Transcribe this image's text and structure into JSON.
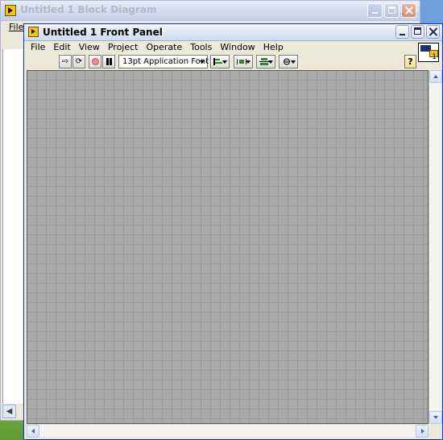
{
  "block_diagram": {
    "title": "Untitled 1 Block Diagram",
    "menu": {
      "file": "File"
    }
  },
  "front_panel": {
    "title": "Untitled 1 Front Panel",
    "menu": [
      "File",
      "Edit",
      "View",
      "Project",
      "Operate",
      "Tools",
      "Window",
      "Help"
    ],
    "toolbar": {
      "font_select_value": "13pt Application Font",
      "help_label": "?"
    },
    "vi_icon": {
      "number": "1"
    }
  },
  "colors": {
    "active_title_border": "#0831d9",
    "canvas_grid": "#a9a9a9"
  },
  "icons": {
    "run": "run-arrow-icon",
    "run_continuous": "run-continuous-icon",
    "abort": "abort-stop-icon",
    "pause": "pause-icon",
    "align": "align-objects-icon",
    "distribute": "distribute-objects-icon",
    "resize": "resize-objects-icon",
    "reorder": "reorder-icon",
    "help": "context-help-icon"
  }
}
